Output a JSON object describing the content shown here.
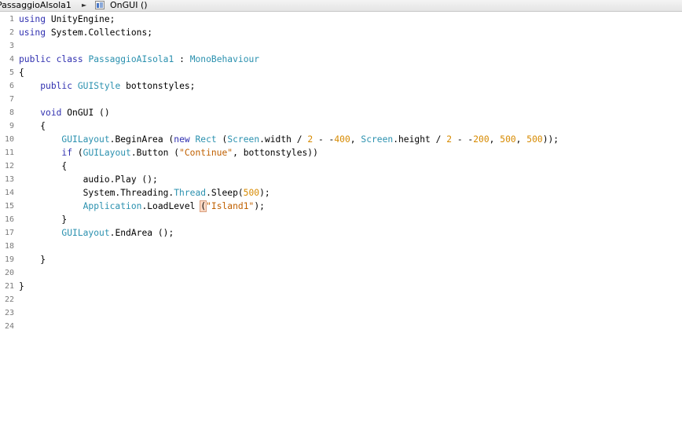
{
  "breadcrumb": {
    "class_name": "PassaggioAIsola1",
    "separator": "►",
    "method_name": "OnGUI ()"
  },
  "editor": {
    "line_numbers": [
      "1",
      "2",
      "3",
      "4",
      "5",
      "6",
      "7",
      "8",
      "9",
      "10",
      "11",
      "12",
      "13",
      "14",
      "15",
      "16",
      "17",
      "18",
      "19",
      "20",
      "21",
      "22",
      "23",
      "24"
    ],
    "lines": [
      [
        {
          "t": "using",
          "c": "kw"
        },
        {
          "t": " UnityEngine;",
          "c": ""
        }
      ],
      [
        {
          "t": "using",
          "c": "kw"
        },
        {
          "t": " System.Collections;",
          "c": ""
        }
      ],
      [],
      [
        {
          "t": "public",
          "c": "kw"
        },
        {
          "t": " ",
          "c": ""
        },
        {
          "t": "class",
          "c": "kw"
        },
        {
          "t": " ",
          "c": ""
        },
        {
          "t": "PassaggioAIsola1",
          "c": "ty"
        },
        {
          "t": " : ",
          "c": ""
        },
        {
          "t": "MonoBehaviour",
          "c": "ty"
        }
      ],
      [
        {
          "t": "{",
          "c": ""
        }
      ],
      [
        {
          "t": "    ",
          "c": ""
        },
        {
          "t": "public",
          "c": "kw"
        },
        {
          "t": " ",
          "c": ""
        },
        {
          "t": "GUIStyle",
          "c": "ty"
        },
        {
          "t": " bottonstyles;",
          "c": ""
        }
      ],
      [],
      [
        {
          "t": "    ",
          "c": ""
        },
        {
          "t": "void",
          "c": "kw"
        },
        {
          "t": " OnGUI ()",
          "c": ""
        }
      ],
      [
        {
          "t": "    {",
          "c": ""
        }
      ],
      [
        {
          "t": "        ",
          "c": ""
        },
        {
          "t": "GUILayout",
          "c": "ty"
        },
        {
          "t": ".BeginArea (",
          "c": ""
        },
        {
          "t": "new",
          "c": "kw"
        },
        {
          "t": " ",
          "c": ""
        },
        {
          "t": "Rect",
          "c": "ty"
        },
        {
          "t": " (",
          "c": ""
        },
        {
          "t": "Screen",
          "c": "ty"
        },
        {
          "t": ".width / ",
          "c": ""
        },
        {
          "t": "2",
          "c": "num"
        },
        {
          "t": " - -",
          "c": ""
        },
        {
          "t": "400",
          "c": "num"
        },
        {
          "t": ", ",
          "c": ""
        },
        {
          "t": "Screen",
          "c": "ty"
        },
        {
          "t": ".height / ",
          "c": ""
        },
        {
          "t": "2",
          "c": "num"
        },
        {
          "t": " - -",
          "c": ""
        },
        {
          "t": "200",
          "c": "num"
        },
        {
          "t": ", ",
          "c": ""
        },
        {
          "t": "500",
          "c": "num"
        },
        {
          "t": ", ",
          "c": ""
        },
        {
          "t": "500",
          "c": "num"
        },
        {
          "t": "));",
          "c": ""
        }
      ],
      [
        {
          "t": "        ",
          "c": ""
        },
        {
          "t": "if",
          "c": "kw"
        },
        {
          "t": " (",
          "c": ""
        },
        {
          "t": "GUILayout",
          "c": "ty"
        },
        {
          "t": ".Button (",
          "c": ""
        },
        {
          "t": "\"Continue\"",
          "c": "str"
        },
        {
          "t": ", bottonstyles))",
          "c": ""
        }
      ],
      [
        {
          "t": "        {",
          "c": ""
        }
      ],
      [
        {
          "t": "            audio.Play ();",
          "c": ""
        }
      ],
      [
        {
          "t": "            System.Threading.",
          "c": ""
        },
        {
          "t": "Thread",
          "c": "ty"
        },
        {
          "t": ".Sleep(",
          "c": ""
        },
        {
          "t": "500",
          "c": "num"
        },
        {
          "t": ");",
          "c": ""
        }
      ],
      [
        {
          "t": "            ",
          "c": ""
        },
        {
          "t": "Application",
          "c": "ty"
        },
        {
          "t": ".LoadLevel ",
          "c": ""
        },
        {
          "t": "(",
          "c": "bracket-hl"
        },
        {
          "t": "\"Island1\"",
          "c": "str"
        },
        {
          "t": ");",
          "c": ""
        }
      ],
      [
        {
          "t": "        }",
          "c": ""
        }
      ],
      [
        {
          "t": "        ",
          "c": ""
        },
        {
          "t": "GUILayout",
          "c": "ty"
        },
        {
          "t": ".EndArea ();",
          "c": ""
        }
      ],
      [],
      [
        {
          "t": "    }",
          "c": ""
        }
      ],
      [],
      [
        {
          "t": "}",
          "c": ""
        }
      ],
      [],
      [],
      []
    ]
  }
}
